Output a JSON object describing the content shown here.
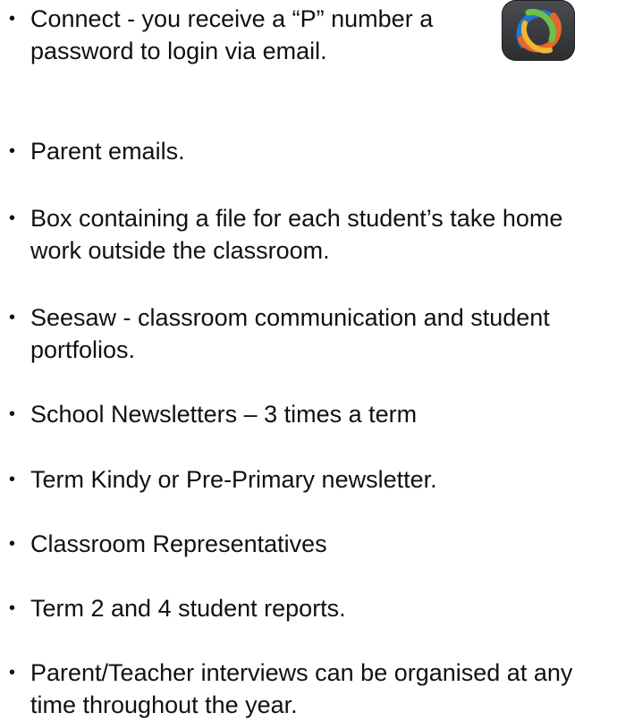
{
  "items": [
    {
      "lines": [
        "Connect - you receive a “P” number a",
        "password to login via email."
      ],
      "icon": "connect-app-icon"
    },
    {
      "lines": [
        "Parent emails."
      ]
    },
    {
      "lines": [
        "Box containing a file for each student’s take home",
        "work outside the classroom."
      ]
    },
    {
      "lines": [
        "Seesaw - classroom communication and student",
        "portfolios."
      ]
    },
    {
      "lines": [
        "School Newsletters – 3 times a term"
      ]
    },
    {
      "lines": [
        "Term Kindy or Pre-Primary newsletter."
      ]
    },
    {
      "lines": [
        "Classroom Representatives"
      ]
    },
    {
      "lines": [
        "Term 2 and 4 student reports."
      ]
    },
    {
      "lines": [
        "Parent/Teacher interviews can be organised at any",
        "time throughout the year."
      ]
    }
  ],
  "colors": {
    "text": "#111111",
    "icon_bg": "#3a3c3f"
  }
}
